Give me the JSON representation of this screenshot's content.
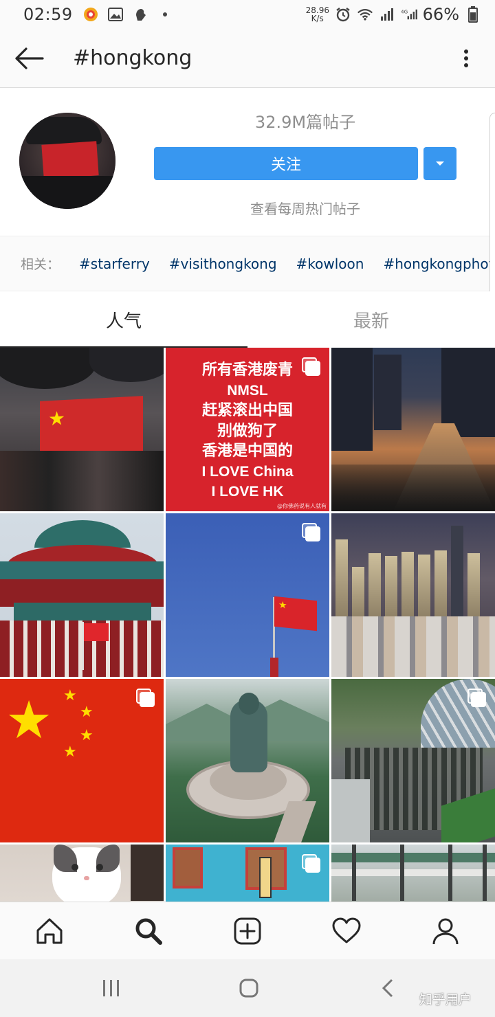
{
  "status_bar": {
    "time": "02:59",
    "net_speed_value": "28.96",
    "net_speed_unit": "K/s",
    "battery": "66%",
    "icons": [
      "circle-app-icon",
      "image-icon",
      "hand-icon",
      "dot-icon",
      "alarm-icon",
      "wifi-icon",
      "signal-icon",
      "signal-4g-icon",
      "battery-icon"
    ]
  },
  "header": {
    "title": "#hongkong",
    "back_icon": "arrow-left-icon",
    "more_icon": "more-vertical-icon"
  },
  "profile": {
    "post_count": "32.9M篇帖子",
    "follow_label": "关注",
    "weekly_label": "查看每周热门帖子"
  },
  "related": {
    "label": "相关：",
    "tags": [
      "#starferry",
      "#visithongkong",
      "#kowloon",
      "#hongkongphoto"
    ]
  },
  "tabs": [
    {
      "label": "人气",
      "active": true
    },
    {
      "label": "最新",
      "active": false
    }
  ],
  "grid": {
    "post2_lines": [
      "所有香港废青",
      "NMSL",
      "赶紧滚出中国",
      "别做狗了",
      "香港是中国的",
      "I LOVE China",
      "I LOVE HK"
    ],
    "post2_watermark": "@你佛药说有人就有"
  },
  "bottom_nav": [
    "home-icon",
    "search-icon",
    "add-post-icon",
    "heart-icon",
    "profile-icon"
  ],
  "system_nav": {
    "watermark": "知乎用户"
  }
}
